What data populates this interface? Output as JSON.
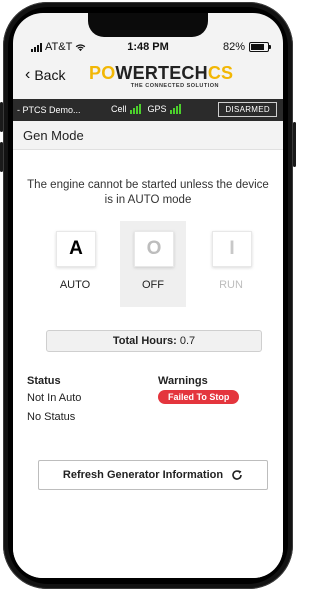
{
  "status_bar": {
    "carrier": "AT&T",
    "time": "1:48 PM",
    "battery_pct": "82%",
    "battery_level": 0.82
  },
  "nav": {
    "back_label": "Back",
    "logo_text_main": "POWERTECHCS",
    "logo_text_sub": "THE CONNECTED SOLUTION"
  },
  "device_bar": {
    "device_name": "- PTCS Demo...",
    "cell_label": "Cell",
    "gps_label": "GPS",
    "arm_state": "DISARMED"
  },
  "section": {
    "title": "Gen Mode"
  },
  "notice": "The engine cannot be started unless the device is in AUTO mode",
  "modes": [
    {
      "key": "A",
      "label": "AUTO",
      "selected": false,
      "enabled": true
    },
    {
      "key": "O",
      "label": "OFF",
      "selected": true,
      "enabled": true
    },
    {
      "key": "I",
      "label": "RUN",
      "selected": false,
      "enabled": false
    }
  ],
  "hours": {
    "label": "Total Hours:",
    "value": "0.7"
  },
  "status": {
    "title": "Status",
    "lines": [
      "Not In Auto",
      "No Status"
    ]
  },
  "warnings": {
    "title": "Warnings",
    "badge": "Failed To Stop"
  },
  "refresh_button": {
    "label": "Refresh Generator Information"
  },
  "colors": {
    "accent_yellow": "#f2b705",
    "signal_green": "#4ccf2c",
    "danger_red": "#e4353d",
    "dark_bar": "#2b2b2b"
  }
}
